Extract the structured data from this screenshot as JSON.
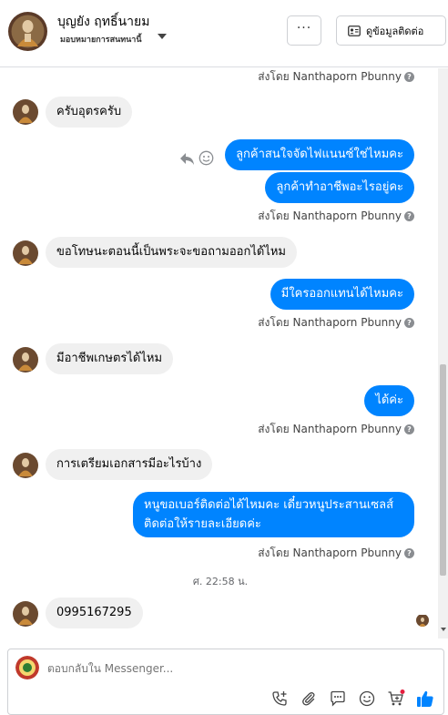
{
  "header": {
    "title": "บุญยัง ฤทธิ์นายม",
    "subtitle": "มอบหมายการสนทนานี้",
    "more_label": "···",
    "contact_label": "ดูข้อมูลติดต่อ"
  },
  "sent_by": {
    "prefix": "ส่งโดย",
    "name": "Nanthaporn Pbunny",
    "help": "?"
  },
  "messages": {
    "m1": "ครับอุตรครับ",
    "m2": "ลูกค้าสนใจจัดไฟแนนซ์ใช่ไหมคะ",
    "m3": "ลูกค้าทำอาชีพอะไรอยู่คะ",
    "m4": "ขอโทษนะตอนนี้เป็นพระจะขอถามออกได้ไหม",
    "m5": "มีใครออกแทนได้ไหมคะ",
    "m6": "มีอาชีพเกษตรได้ไหม",
    "m7": "ได้ค่ะ",
    "m8": "การเตรียมเอกสารมีอะไรบ้าง",
    "m9": "หนูขอเบอร์ติดต่อได้ไหมคะ เดี๋ยวหนูประสานเซลส์ติดต่อให้รายละเอียดค่ะ",
    "m10": "0995167295"
  },
  "timestamp": "ศ. 22:58 น.",
  "composer": {
    "placeholder": "ตอบกลับใน Messenger..."
  },
  "icons": {
    "reply": "reply-icon",
    "react": "smiley-icon",
    "tools": [
      "phone-plus-icon",
      "paperclip-icon",
      "chat-bubble-icon",
      "emoji-icon",
      "cart-plus-icon",
      "thumbs-up-icon"
    ]
  },
  "colors": {
    "outgoing_bubble": "#0084ff",
    "incoming_bubble": "#f0f0f0",
    "like_blue": "#0084ff",
    "notif_dot": "#e41e3f"
  }
}
